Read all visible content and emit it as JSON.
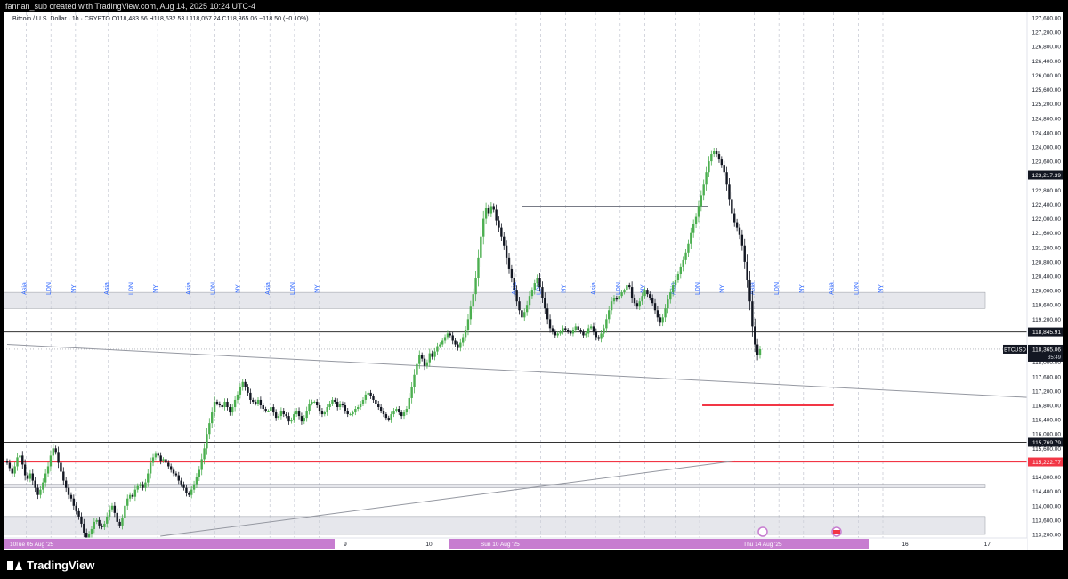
{
  "header": {
    "credit": "fannan_sub created with TradingView.com, Aug 14, 2025 10:24 UTC-4"
  },
  "legend": {
    "text": "Bitcoin / U.S. Dollar · 1h · CRYPTO  O118,483.56  H118,632.53  L118,057.24  C118,365.06  −118.50 (−0.10%)"
  },
  "brand": {
    "name": "TradingView"
  },
  "colors": {
    "up": "#4caf50",
    "down": "#131722",
    "sessions": "#2962ff",
    "red_level": "#f23645",
    "x_highlight": "#c77dd0"
  },
  "chart_data": {
    "type": "candlestick",
    "symbol": "BTCUSD",
    "y_axis": {
      "min": 113200,
      "max": 127600,
      "ticks": [
        "113,200.00",
        "113,600.00",
        "114,000.00",
        "114,400.00",
        "114,800.00",
        "115,200.00",
        "115,600.00",
        "116,000.00",
        "116,400.00",
        "116,800.00",
        "117,200.00",
        "117,600.00",
        "118,000.00",
        "118,400.00",
        "118,800.00",
        "119,200.00",
        "119,600.00",
        "120,000.00",
        "120,400.00",
        "120,800.00",
        "121,200.00",
        "121,600.00",
        "122,000.00",
        "122,400.00",
        "122,800.00",
        "123,200.00",
        "123,600.00",
        "124,000.00",
        "124,400.00",
        "124,800.00",
        "125,200.00",
        "125,600.00",
        "126,000.00",
        "126,400.00",
        "126,800.00",
        "127,200.00",
        "127,600.00"
      ]
    },
    "price_labels": [
      {
        "text": "123,217.39",
        "value": 123217.39
      },
      {
        "text": "118,845.91",
        "value": 118845.91
      },
      {
        "text": "115,769.79",
        "value": 115769.79
      },
      {
        "text": "115,222.77",
        "value": 115222.77,
        "red": true
      }
    ],
    "current": {
      "symbol_tag": "BTCUSD",
      "price": "118,365.06",
      "value": 118365.06,
      "countdown": "35:49"
    },
    "x_labels": [
      {
        "text": "10",
        "t": 0
      },
      {
        "text": "Tue 05 Aug '25",
        "t": 0.1
      },
      {
        "text": "9",
        "t": 6.1
      },
      {
        "text": "10",
        "t": 7.6
      },
      {
        "text": "Sun 10 Aug '25",
        "t": 8.6
      },
      {
        "text": "Thu 14 Aug '25",
        "t": 13.4
      },
      {
        "text": "16",
        "t": 16.3
      },
      {
        "text": "17",
        "t": 17.8
      }
    ],
    "session_labels": [
      {
        "text": "Asia",
        "t": 0.35
      },
      {
        "text": "LDN",
        "t": 0.8
      },
      {
        "text": "NY",
        "t": 1.25
      },
      {
        "text": "Asia",
        "t": 1.85
      },
      {
        "text": "LDN",
        "t": 2.3
      },
      {
        "text": "NY",
        "t": 2.75
      },
      {
        "text": "Asia",
        "t": 3.35
      },
      {
        "text": "LDN",
        "t": 3.8
      },
      {
        "text": "NY",
        "t": 4.25
      },
      {
        "text": "Asia",
        "t": 4.8
      },
      {
        "text": "LDN",
        "t": 5.25
      },
      {
        "text": "NY",
        "t": 5.7
      },
      {
        "text": "Asia",
        "t": 9.3
      },
      {
        "text": "LDN",
        "t": 9.75
      },
      {
        "text": "NY",
        "t": 10.2
      },
      {
        "text": "Asia",
        "t": 10.75
      },
      {
        "text": "LDN",
        "t": 11.2
      },
      {
        "text": "NY",
        "t": 11.65
      },
      {
        "text": "Asia",
        "t": 12.2
      },
      {
        "text": "LDN",
        "t": 12.65
      },
      {
        "text": "NY",
        "t": 13.1
      },
      {
        "text": "Asia",
        "t": 13.65
      },
      {
        "text": "LDN",
        "t": 14.1
      },
      {
        "text": "NY",
        "t": 14.55
      },
      {
        "text": "Asia",
        "t": 15.1
      },
      {
        "text": "LDN",
        "t": 15.55
      },
      {
        "text": "NY",
        "t": 16.0
      }
    ],
    "zones": [
      {
        "from": 119500,
        "to": 119950
      },
      {
        "from": 113200,
        "to": 113700
      },
      {
        "from": 114500,
        "to": 114600
      }
    ],
    "trendlines": [
      {
        "t1": 0,
        "p1": 118500,
        "t2": 18.9,
        "p2": 117000
      },
      {
        "t1": 2.8,
        "p1": 113150,
        "t2": 13.3,
        "p2": 115250
      }
    ],
    "red_segment": {
      "t1": 12.7,
      "t2": 15.1,
      "value": 116800
    },
    "top_segment": {
      "t1": 9.4,
      "t2": 12.8,
      "value": 122350
    },
    "closes": [
      115200,
      115050,
      114900,
      115100,
      115350,
      115400,
      115150,
      114850,
      114750,
      114900,
      114700,
      114500,
      114300,
      114450,
      114650,
      114900,
      115100,
      115400,
      115600,
      115500,
      115200,
      114950,
      114700,
      114500,
      114300,
      114200,
      114000,
      113850,
      113700,
      113500,
      113250,
      113050,
      113200,
      113350,
      113550,
      113600,
      113450,
      113400,
      113500,
      113700,
      113900,
      114000,
      113800,
      113550,
      113450,
      113650,
      114000,
      114200,
      114300,
      114250,
      114450,
      114550,
      114600,
      114500,
      114650,
      114900,
      115200,
      115350,
      115450,
      115400,
      115250,
      115300,
      115200,
      115100,
      115000,
      114900,
      114850,
      114700,
      114600,
      114500,
      114350,
      114300,
      114450,
      114600,
      114800,
      115000,
      115300,
      115600,
      116000,
      116300,
      116600,
      116900,
      116850,
      116800,
      116750,
      116900,
      116750,
      116600,
      116750,
      116950,
      117100,
      117300,
      117450,
      117300,
      117150,
      116950,
      116900,
      116850,
      116950,
      116800,
      116700,
      116650,
      116650,
      116750,
      116600,
      116450,
      116500,
      116650,
      116550,
      116500,
      116350,
      116400,
      116550,
      116650,
      116500,
      116350,
      116450,
      116650,
      116850,
      116900,
      116900,
      116800,
      116650,
      116550,
      116600,
      116750,
      116850,
      116950,
      116900,
      116750,
      116850,
      116800,
      116650,
      116550,
      116550,
      116600,
      116700,
      116750,
      116850,
      116950,
      117100,
      117150,
      117050,
      116950,
      116850,
      116750,
      116650,
      116550,
      116450,
      116400,
      116550,
      116650,
      116700,
      116600,
      116500,
      116600,
      116700,
      117000,
      117300,
      117650,
      117950,
      118200,
      118100,
      117900,
      118000,
      118250,
      118150,
      118300,
      118450,
      118500,
      118600,
      118700,
      118800,
      118750,
      118600,
      118500,
      118400,
      118550,
      118700,
      118900,
      119200,
      119550,
      119900,
      120350,
      120900,
      121500,
      122000,
      122300,
      122150,
      122350,
      122250,
      121950,
      121750,
      121500,
      121250,
      120900,
      120600,
      120350,
      120000,
      119700,
      119450,
      119250,
      119400,
      119600,
      119850,
      120000,
      120200,
      120350,
      120100,
      119800,
      119500,
      119200,
      118950,
      118850,
      118750,
      118800,
      118850,
      118950,
      118900,
      118850,
      118800,
      118900,
      119000,
      118900,
      118850,
      118750,
      118800,
      118950,
      119000,
      118850,
      118700,
      118650,
      118800,
      118950,
      119200,
      119450,
      119700,
      119800,
      119750,
      119850,
      119950,
      120000,
      120150,
      120100,
      119800,
      119650,
      119550,
      119700,
      119850,
      120000,
      119900,
      119800,
      119650,
      119450,
      119250,
      119100,
      119250,
      119500,
      119750,
      119950,
      120150,
      120300,
      120450,
      120650,
      120850,
      121050,
      121300,
      121600,
      121850,
      122050,
      122350,
      122650,
      122950,
      123300,
      123600,
      123800,
      123900,
      123800,
      123650,
      123500,
      123300,
      122950,
      122550,
      122150,
      121900,
      121750,
      121550,
      121250,
      120800,
      120300,
      119700,
      119000,
      118500,
      118200,
      118365
    ]
  }
}
